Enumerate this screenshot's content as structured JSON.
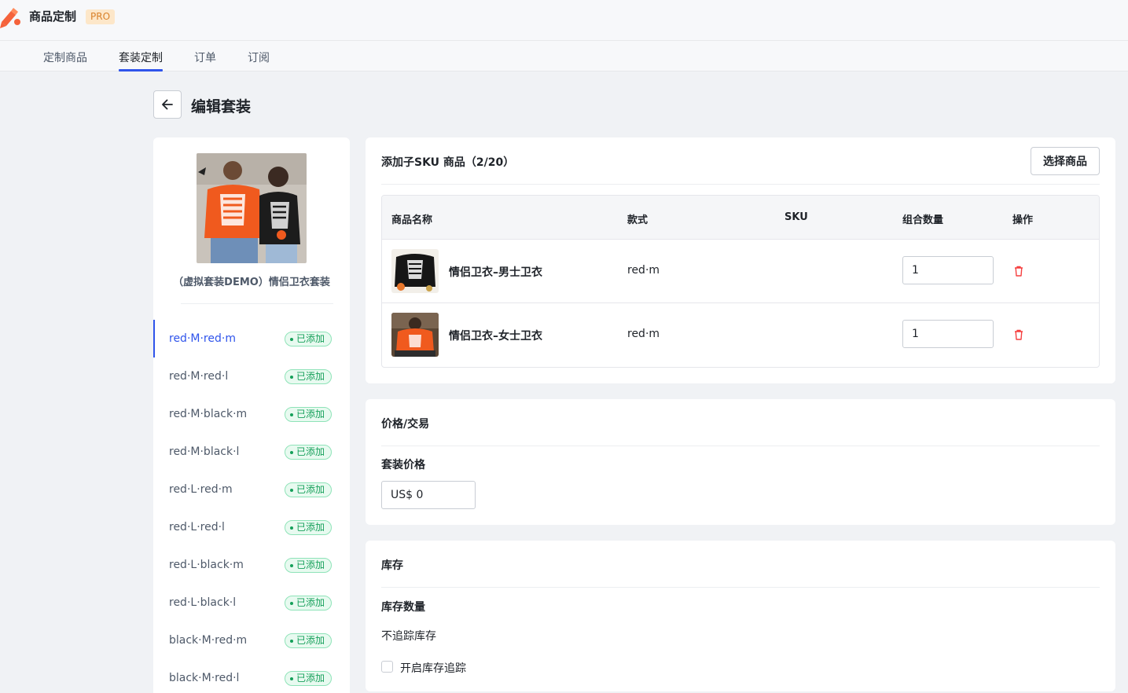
{
  "header": {
    "app_title": "商品定制",
    "badge": "PRO"
  },
  "tabs": [
    {
      "label": "定制商品"
    },
    {
      "label": "套装定制"
    },
    {
      "label": "订单"
    },
    {
      "label": "订阅"
    }
  ],
  "active_tab": "套装定制",
  "page": {
    "title": "编辑套装"
  },
  "bundle": {
    "name": "（虚拟套装DEMO）情侣卫衣套装",
    "variants": [
      {
        "label": "red·M·red·m",
        "status": "已添加"
      },
      {
        "label": "red·M·red·l",
        "status": "已添加"
      },
      {
        "label": "red·M·black·m",
        "status": "已添加"
      },
      {
        "label": "red·M·black·l",
        "status": "已添加"
      },
      {
        "label": "red·L·red·m",
        "status": "已添加"
      },
      {
        "label": "red·L·red·l",
        "status": "已添加"
      },
      {
        "label": "red·L·black·m",
        "status": "已添加"
      },
      {
        "label": "red·L·black·l",
        "status": "已添加"
      },
      {
        "label": "black·M·red·m",
        "status": "已添加"
      },
      {
        "label": "black·M·red·l",
        "status": "已添加"
      }
    ],
    "selected_variant": "red·M·red·m"
  },
  "sku_section": {
    "title": "添加子SKU 商品（2/20）",
    "select_button": "选择商品",
    "columns": [
      "商品名称",
      "款式",
      "SKU",
      "组合数量",
      "操作"
    ],
    "rows": [
      {
        "name": "情侣卫衣–男士卫衣",
        "style": "red·m",
        "sku": "",
        "qty": "1"
      },
      {
        "name": "情侣卫衣–女士卫衣",
        "style": "red·m",
        "sku": "",
        "qty": "1"
      }
    ]
  },
  "price_section": {
    "title": "价格/交易",
    "price_label": "套装价格",
    "price_value": "US$ 0"
  },
  "stock_section": {
    "title": "库存",
    "qty_label": "库存数量",
    "tracking_text": "不追踪库存",
    "enable_tracking_label": "开启库存追踪",
    "enable_tracking_checked": false
  },
  "colors": {
    "accent": "#2f54eb",
    "badge_green": "#16a05a",
    "delete_red": "#f53f3f",
    "pro_badge": "#d9822b"
  }
}
